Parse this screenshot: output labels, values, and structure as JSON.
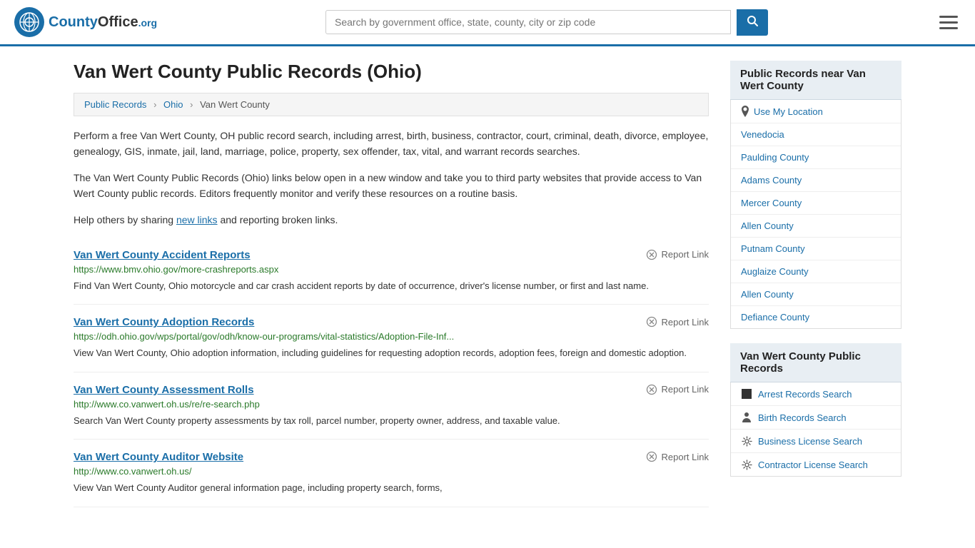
{
  "header": {
    "logo_text": "CountyOffice",
    "logo_org": ".org",
    "search_placeholder": "Search by government office, state, county, city or zip code",
    "search_value": ""
  },
  "page": {
    "title": "Van Wert County Public Records (Ohio)",
    "breadcrumb": {
      "items": [
        "Public Records",
        "Ohio",
        "Van Wert County"
      ]
    },
    "description1": "Perform a free Van Wert County, OH public record search, including arrest, birth, business, contractor, court, criminal, death, divorce, employee, genealogy, GIS, inmate, jail, land, marriage, police, property, sex offender, tax, vital, and warrant records searches.",
    "description2": "The Van Wert County Public Records (Ohio) links below open in a new window and take you to third party websites that provide access to Van Wert County public records. Editors frequently monitor and verify these resources on a routine basis.",
    "description3_prefix": "Help others by sharing ",
    "description3_link": "new links",
    "description3_suffix": " and reporting broken links."
  },
  "records": [
    {
      "title": "Van Wert County Accident Reports",
      "url": "https://www.bmv.ohio.gov/more-crashreports.aspx",
      "description": "Find Van Wert County, Ohio motorcycle and car crash accident reports by date of occurrence, driver's license number, or first and last name.",
      "report_label": "Report Link"
    },
    {
      "title": "Van Wert County Adoption Records",
      "url": "https://odh.ohio.gov/wps/portal/gov/odh/know-our-programs/vital-statistics/Adoption-File-Inf...",
      "description": "View Van Wert County, Ohio adoption information, including guidelines for requesting adoption records, adoption fees, foreign and domestic adoption.",
      "report_label": "Report Link"
    },
    {
      "title": "Van Wert County Assessment Rolls",
      "url": "http://www.co.vanwert.oh.us/re/re-search.php",
      "description": "Search Van Wert County property assessments by tax roll, parcel number, property owner, address, and taxable value.",
      "report_label": "Report Link"
    },
    {
      "title": "Van Wert County Auditor Website",
      "url": "http://www.co.vanwert.oh.us/",
      "description": "View Van Wert County Auditor general information page, including property search, forms,",
      "report_label": "Report Link"
    }
  ],
  "sidebar": {
    "nearby_section": {
      "header": "Public Records near Van Wert County",
      "use_location": "Use My Location",
      "items": [
        "Venedocia",
        "Paulding County",
        "Adams County",
        "Mercer County",
        "Allen County",
        "Putnam County",
        "Auglaize County",
        "Allen County",
        "Defiance County"
      ]
    },
    "records_section": {
      "header": "Van Wert County Public Records",
      "items": [
        {
          "label": "Arrest Records Search",
          "icon": "arrest"
        },
        {
          "label": "Birth Records Search",
          "icon": "birth"
        },
        {
          "label": "Business License Search",
          "icon": "gear"
        },
        {
          "label": "Contractor License Search",
          "icon": "gear"
        }
      ]
    }
  }
}
